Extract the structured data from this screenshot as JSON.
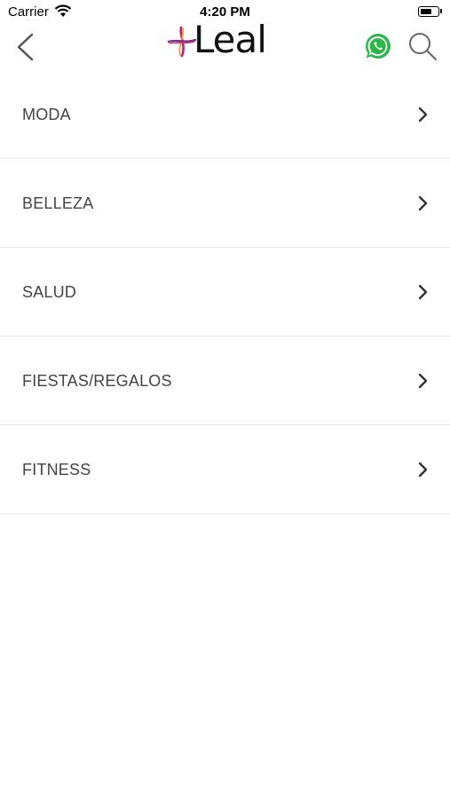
{
  "status_bar": {
    "carrier": "Carrier",
    "time": "4:20 PM"
  },
  "nav": {
    "logo_text": "Leal",
    "icons": [
      "back-icon",
      "whatsapp-icon",
      "search-icon"
    ]
  },
  "categories": [
    {
      "label": "MODA"
    },
    {
      "label": "BELLEZA"
    },
    {
      "label": "SALUD"
    },
    {
      "label": "FIESTAS/REGALOS"
    },
    {
      "label": "FITNESS"
    }
  ],
  "colors": {
    "whatsapp_green": "#2fb64a",
    "logo_magenta": "#c81b7d",
    "divider": "#e6e6e6"
  }
}
